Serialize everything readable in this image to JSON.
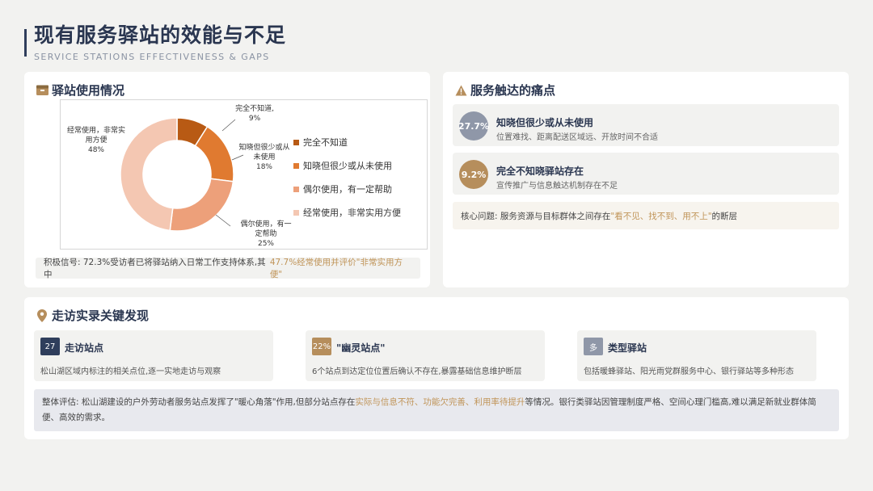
{
  "header": {
    "title": "现有服务驿站的效能与不足",
    "subtitle": "SERVICE STATIONS EFFECTIVENESS & GAPS"
  },
  "usage": {
    "title": "驿站使用情况",
    "note_prefix": "积极信号: 72.3%受访者已将驿站纳入日常工作支持体系,其中",
    "note_highlight": "47.7%经常使用并评价\"非常实用方便\""
  },
  "chart_data": {
    "type": "pie",
    "donut": true,
    "categories": [
      "完全不知道",
      "知晓但很少或从未使用",
      "偶尔使用，有一定帮助",
      "经常使用，非常实用方便"
    ],
    "values": [
      9,
      18,
      25,
      48
    ],
    "unit": "%",
    "colors": [
      "#b85a14",
      "#e07a30",
      "#eda07a",
      "#f4c7b2"
    ],
    "data_labels": [
      [
        "完全不知道,",
        "9%"
      ],
      [
        "知晓但很少或从",
        "未使用",
        "18%"
      ],
      [
        "偶尔使用，有一",
        "定帮助",
        "25%"
      ],
      [
        "经常使用，非常实",
        "用方便",
        "48%"
      ]
    ],
    "legend": [
      "完全不知道",
      "知晓但很少或从未使用",
      "偶尔使用，有一定帮助",
      "经常使用，非常实用方便"
    ],
    "legend_position": "right"
  },
  "pain": {
    "title": "服务触达的痛点",
    "items": [
      {
        "badge": "27.7%",
        "title": "知晓但很少或从未使用",
        "desc": "位置难找、距离配送区域远、开放时间不合适",
        "color": "#8f97a8"
      },
      {
        "badge": "9.2%",
        "title": "完全不知晓驿站存在",
        "desc": "宣传推广与信息触达机制存在不足",
        "color": "#b68e5c"
      }
    ],
    "core_prefix": "核心问题: 服务资源与目标群体之间存在",
    "core_highlight": "\"看不见、找不到、用不上\"",
    "core_suffix": "的断层"
  },
  "visit": {
    "title": "走访实录关键发现",
    "boxes": [
      {
        "badge": "27",
        "title": "走访站点",
        "desc": "松山湖区域内标注的相关点位,逐一实地走访与观察",
        "color": "#2f3e5c"
      },
      {
        "badge": "22%",
        "title": "\"幽灵站点\"",
        "desc": "6个站点到达定位位置后确认不存在,暴露基础信息维护断层",
        "color": "#b68e5c"
      },
      {
        "badge": "多",
        "title": "类型驿站",
        "desc": "包括暖蜂驿站、阳光雨党群服务中心、银行驿站等多种形态",
        "color": "#8f97a8"
      }
    ],
    "eval_prefix": "整体评估: 松山湖建设的户外劳动者服务站点发挥了\"暖心角落\"作用,但部分站点存在",
    "eval_highlight": "实际与信息不符、功能欠完善、利用率待提升",
    "eval_suffix": "等情况。银行类驿站因管理制度严格、空间心理门槛高,难以满足新就业群体简便、高效的需求。"
  }
}
